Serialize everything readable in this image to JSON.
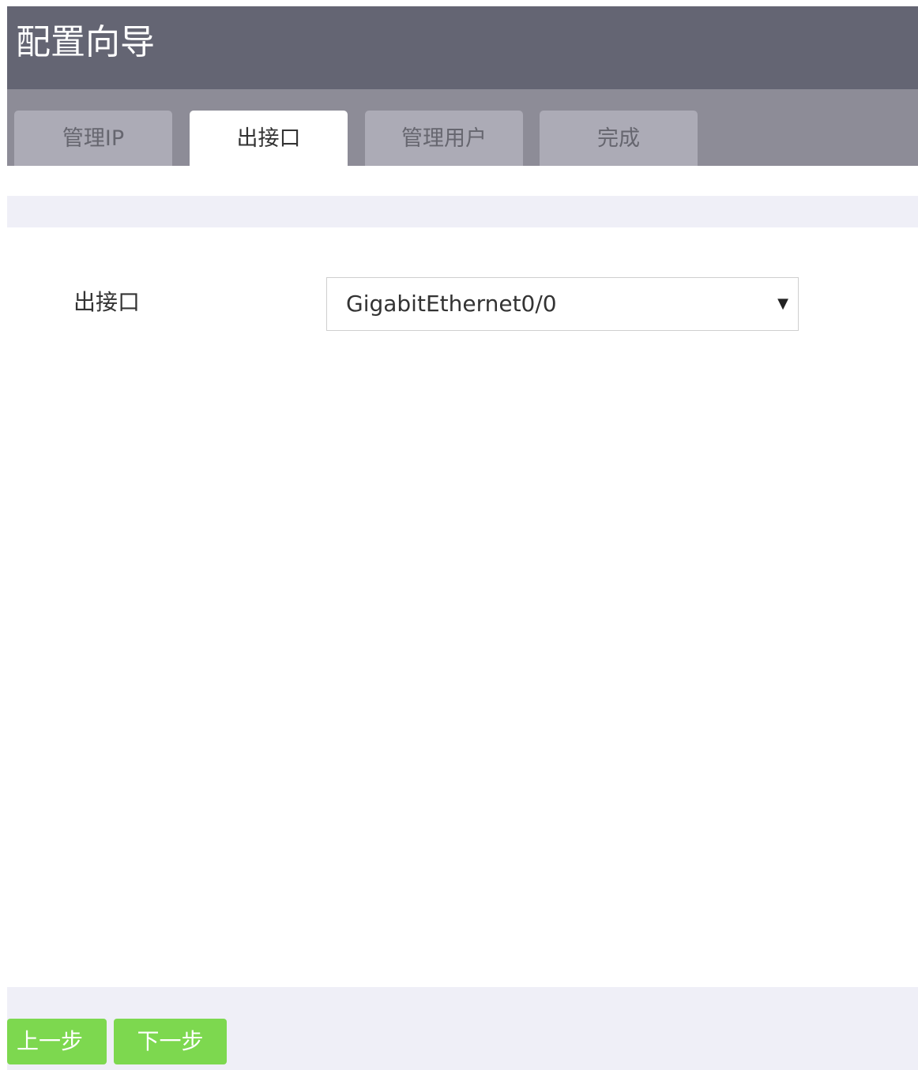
{
  "header": {
    "title": "配置向导"
  },
  "tabs": [
    {
      "label": "管理IP",
      "active": false
    },
    {
      "label": "出接口",
      "active": true
    },
    {
      "label": "管理用户",
      "active": false
    },
    {
      "label": "完成",
      "active": false
    }
  ],
  "form": {
    "interface_label": "出接口",
    "interface_select": {
      "value": "GigabitEthernet0/0",
      "arrow": "▼"
    }
  },
  "footer": {
    "prev_label": "上一步",
    "next_label": "下一步"
  },
  "colors": {
    "header_bg": "#646573",
    "tabstrip_bg": "#8d8c97",
    "tab_inactive_bg": "#acabb6",
    "button_green": "#7dd84f",
    "panel_bg": "#efeff7"
  }
}
